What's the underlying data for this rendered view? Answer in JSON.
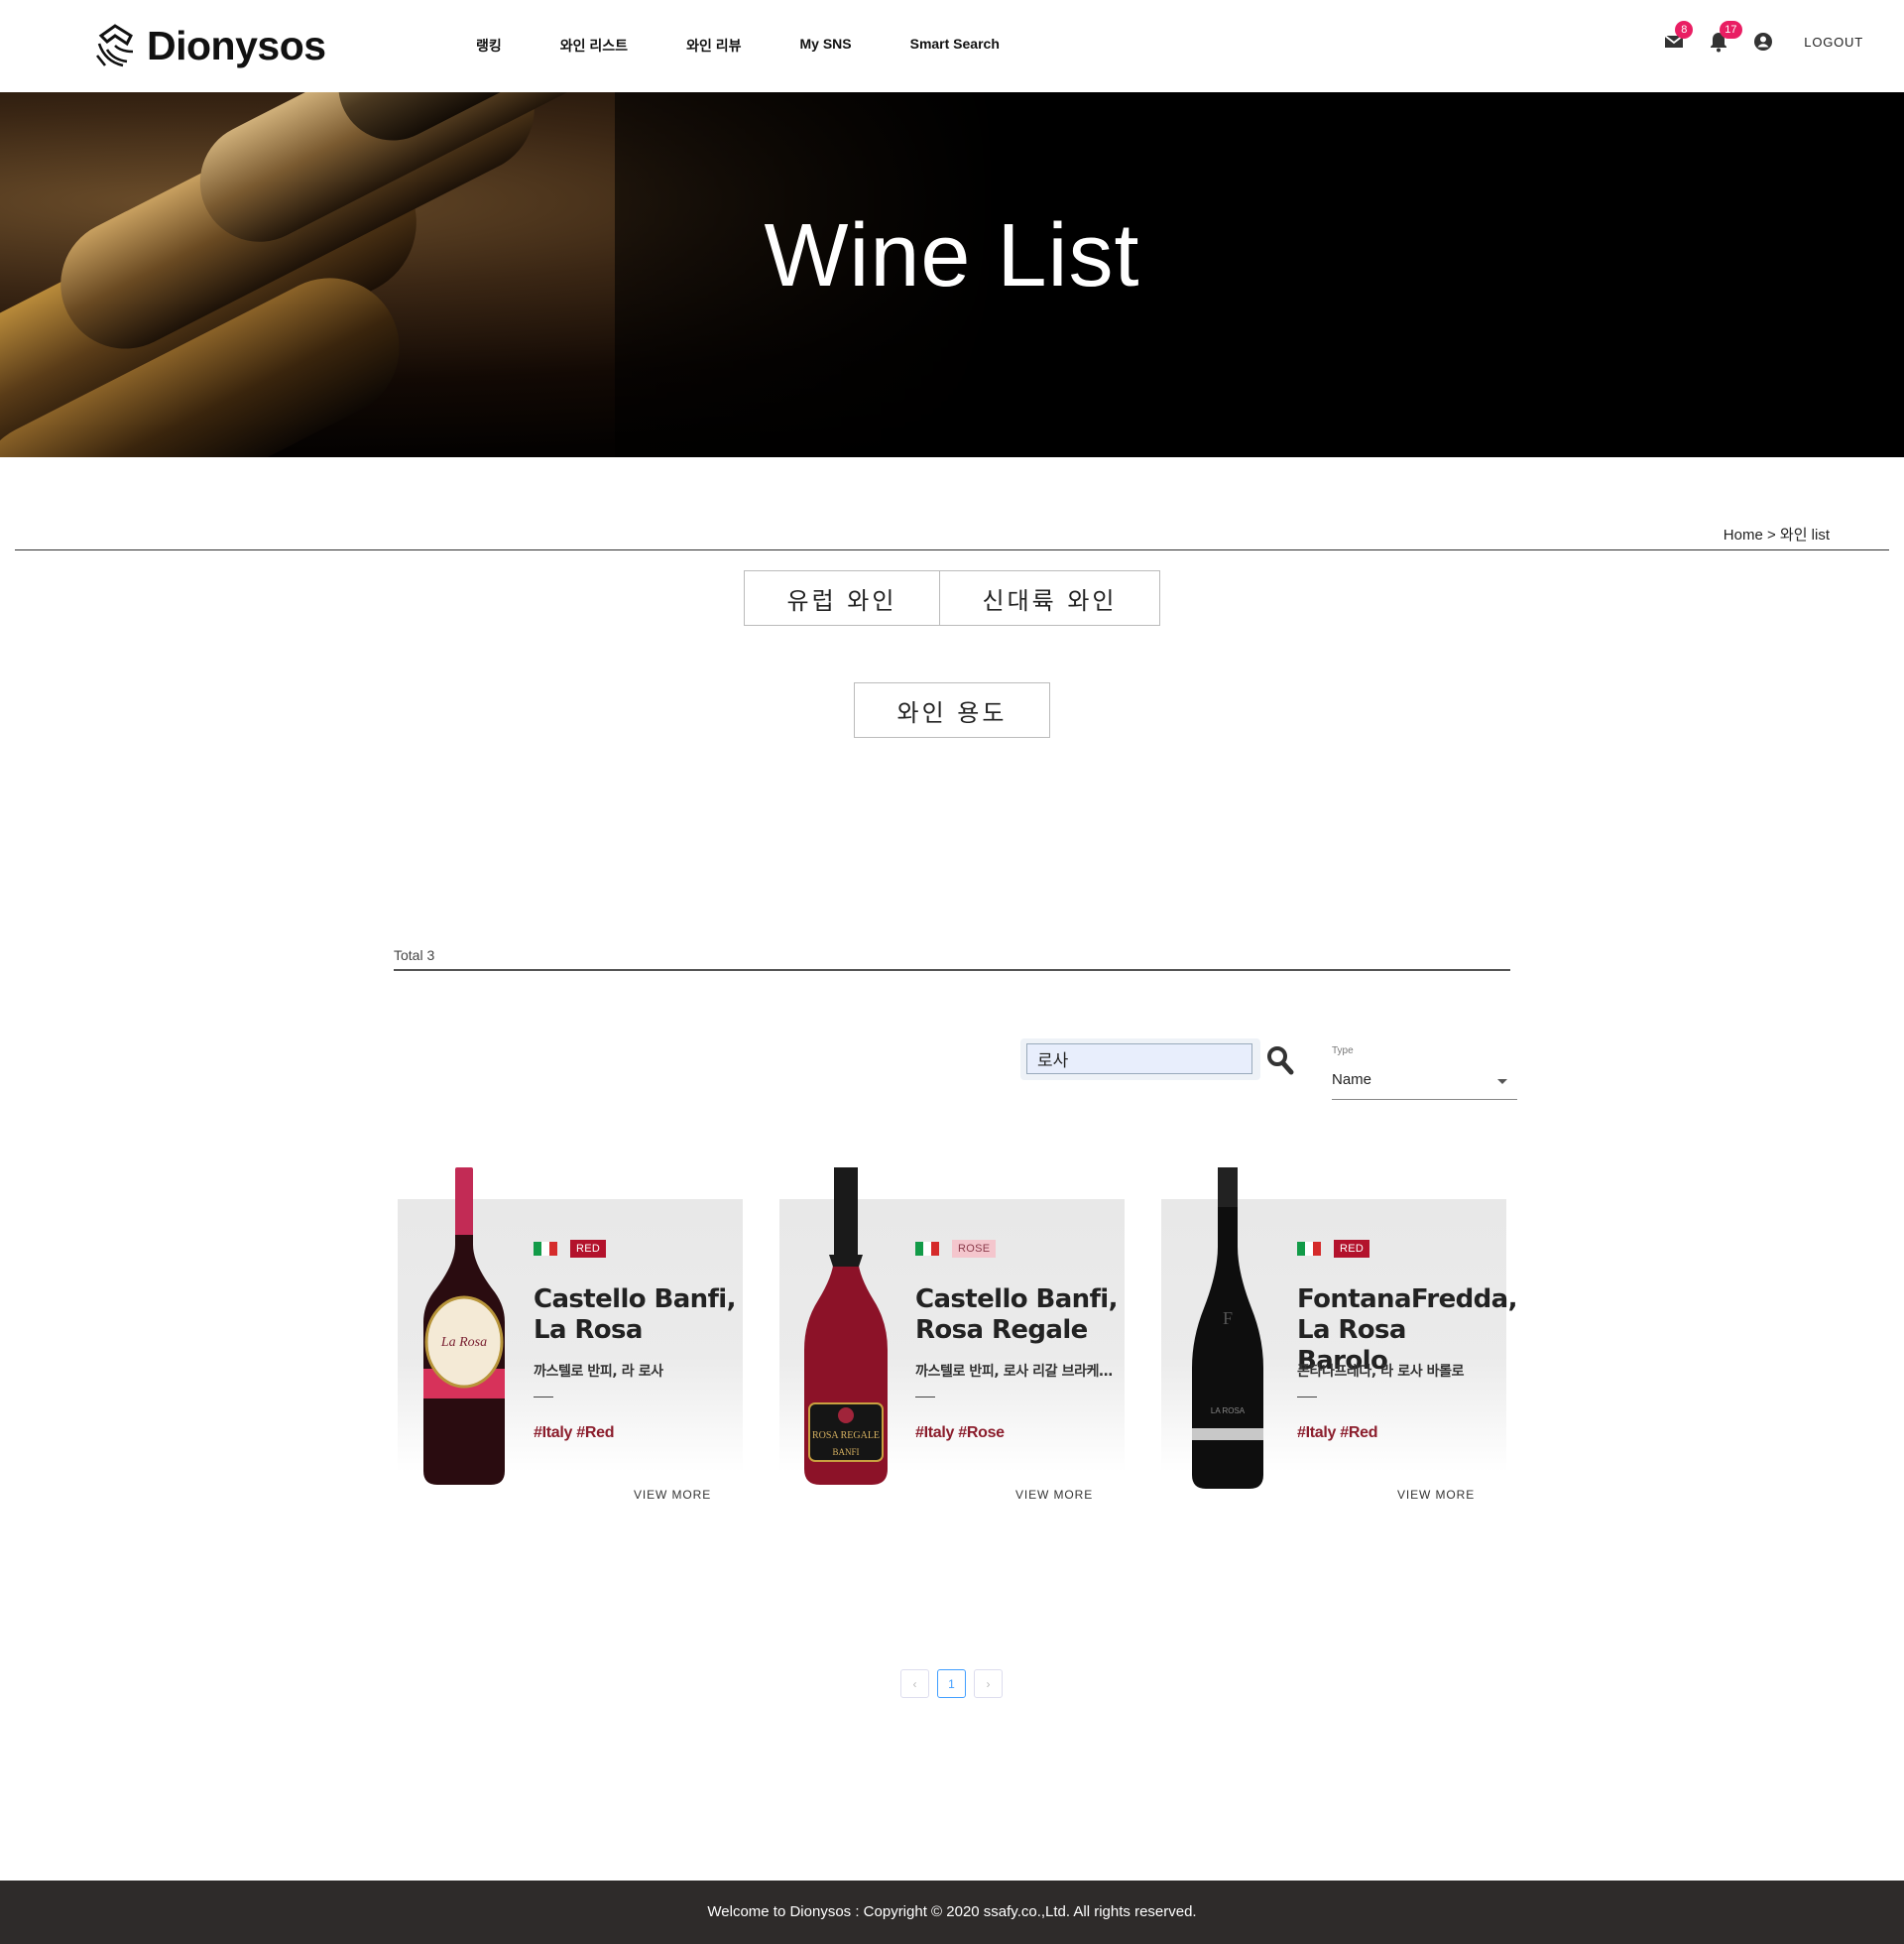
{
  "header": {
    "logo_text": "Dionysos",
    "nav": [
      "랭킹",
      "와인 리스트",
      "와인 리뷰",
      "My SNS",
      "Smart Search"
    ],
    "mail_count": "8",
    "notification_count": "17",
    "logout_label": "LOGOUT"
  },
  "hero": {
    "title": "Wine List"
  },
  "breadcrumb": "Home > 와인 list",
  "categories": {
    "europe": "유럽 와인",
    "new_world": "신대륙 와인",
    "usage": "와인 용도"
  },
  "total_label": "Total 3",
  "search": {
    "value": "로사"
  },
  "type_filter": {
    "label": "Type",
    "selected": "Name"
  },
  "wines": [
    {
      "type_tag": "RED",
      "name": "Castello Banfi, La Rosa",
      "korean_name": "까스텔로 반피, 라 로사",
      "hashtags": "#Italy #Red",
      "view_more": "VIEW MORE"
    },
    {
      "type_tag": "ROSE",
      "name": "Castello Banfi, Rosa Regale",
      "korean_name": "까스텔로 반피, 로사 리갈 브라케토 다퀴",
      "hashtags": "#Italy #Rose",
      "view_more": "VIEW MORE"
    },
    {
      "type_tag": "RED",
      "name": "FontanaFredda, La Rosa Barolo",
      "korean_name": "폰타나프레다, 라 로사 바롤로",
      "hashtags": "#Italy #Red",
      "view_more": "VIEW MORE"
    }
  ],
  "pagination": {
    "prev": "‹",
    "current": "1",
    "next": "›"
  },
  "footer": "Welcome to Dionysos : Copyright © 2020 ssafy.co.,Ltd. All rights reserved.",
  "colors": {
    "accent_red": "#b3122c",
    "badge": "#e91e63",
    "footer_bg": "#2e2b2a",
    "hashtag": "#8b1d2c"
  }
}
